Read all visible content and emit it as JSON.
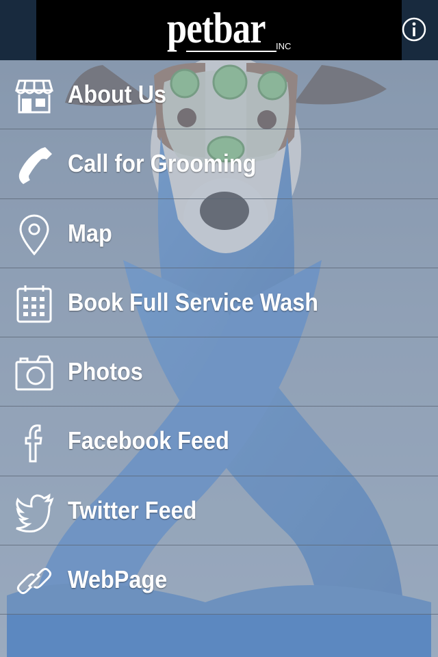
{
  "header": {
    "logo_text": "petbar",
    "logo_suffix": "INC",
    "info_icon": "info-circle-icon"
  },
  "menu": {
    "items": [
      {
        "label": "About Us",
        "icon": "storefront-icon"
      },
      {
        "label": "Call for Grooming",
        "icon": "phone-icon"
      },
      {
        "label": "Map",
        "icon": "map-pin-icon"
      },
      {
        "label": "Book Full Service Wash",
        "icon": "calendar-icon"
      },
      {
        "label": "Photos",
        "icon": "camera-icon"
      },
      {
        "label": "Facebook Feed",
        "icon": "facebook-icon"
      },
      {
        "label": "Twitter Feed",
        "icon": "twitter-icon"
      },
      {
        "label": "WebPage",
        "icon": "link-icon"
      }
    ]
  },
  "colors": {
    "header_bg": "#000000",
    "header_side": "#182a3e",
    "text": "#ffffff",
    "towel": "#3b78c2"
  }
}
